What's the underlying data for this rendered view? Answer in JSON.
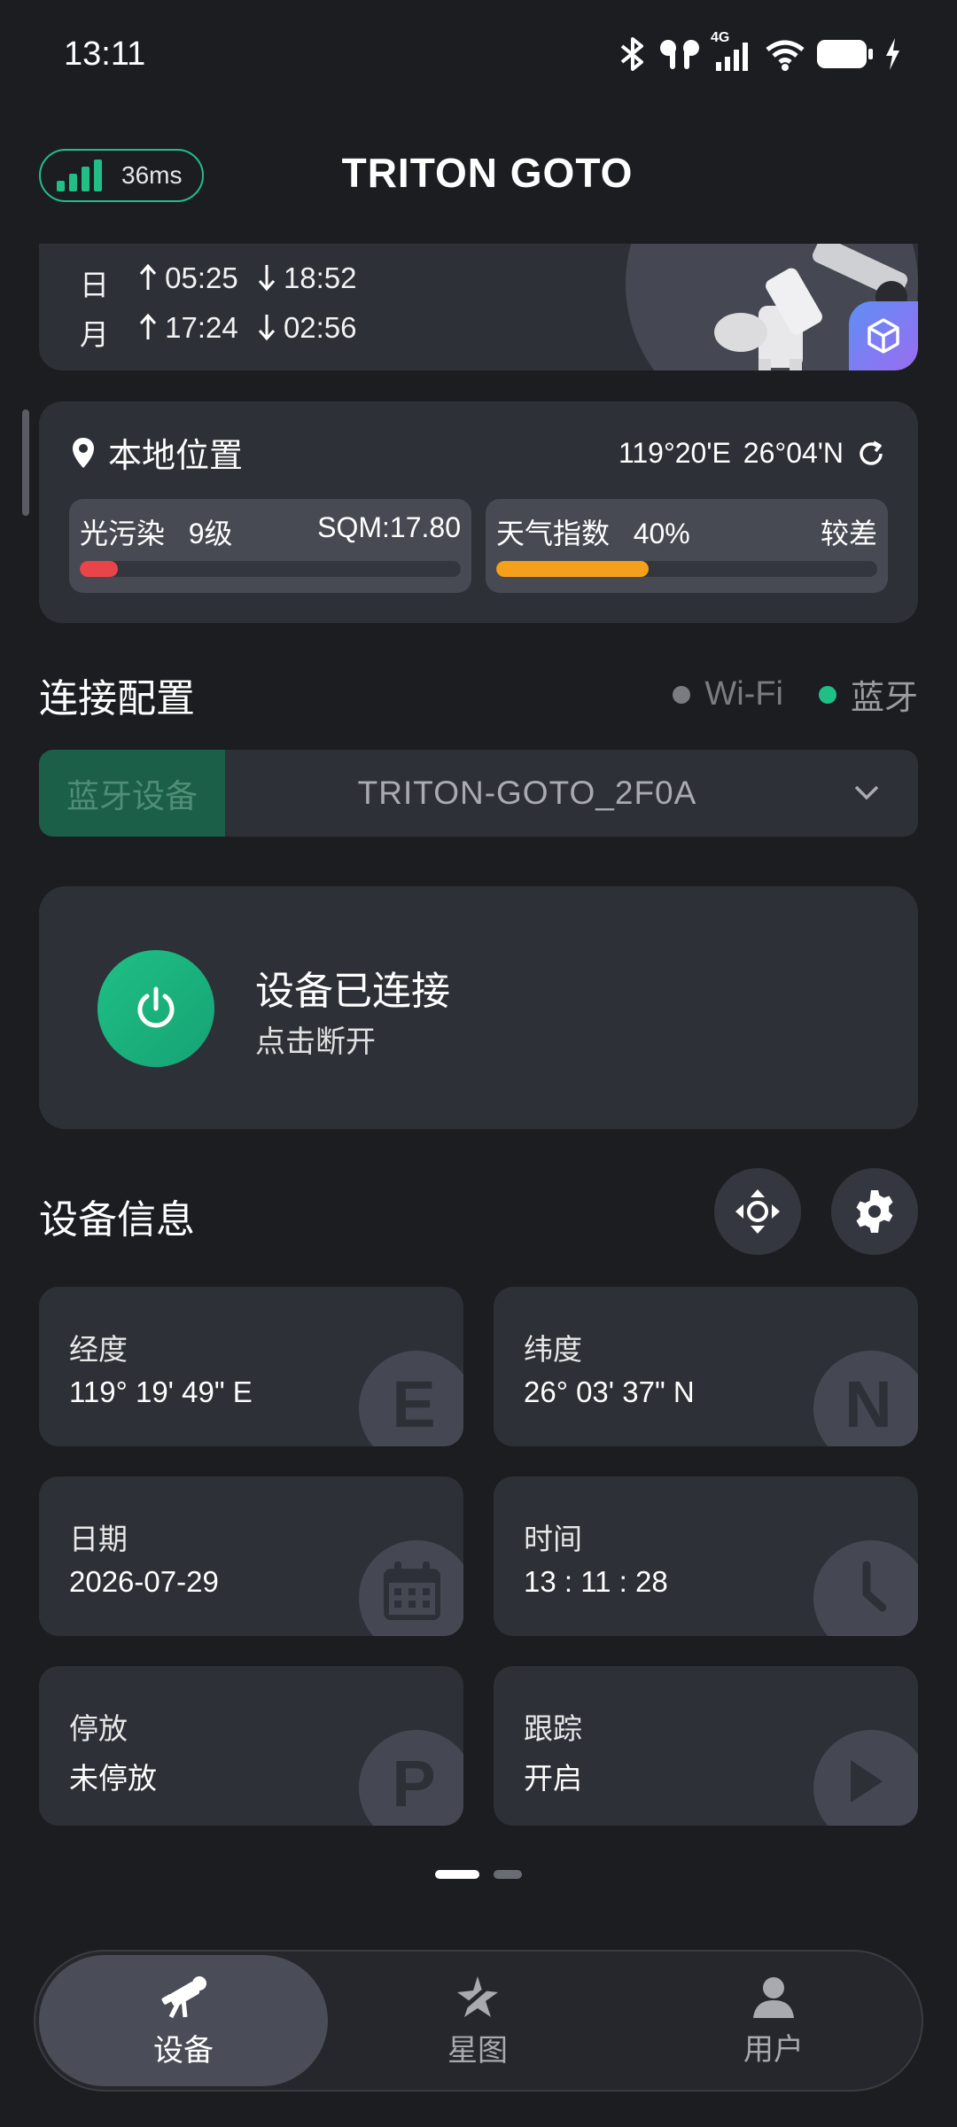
{
  "status_bar": {
    "time": "13:11",
    "network_label": "4G"
  },
  "header": {
    "latency": "36ms",
    "title": "TRITON GOTO"
  },
  "sun_moon": {
    "sun_label": "日",
    "sunrise": "05:25",
    "sunset": "18:52",
    "moon_label": "月",
    "moonrise": "17:24",
    "moonset": "02:56"
  },
  "location": {
    "title": "本地位置",
    "longitude": "119°20'E",
    "latitude": "26°04'N",
    "light_pollution": {
      "label": "光污染",
      "level": "9级",
      "sqm": "SQM:17.80",
      "fill_fraction": 0.1,
      "color": "#e9444a"
    },
    "weather": {
      "label": "天气指数",
      "percent": "40%",
      "rating": "较差",
      "fill_fraction": 0.4,
      "color": "#f5a01a"
    }
  },
  "connection": {
    "title": "连接配置",
    "modes": [
      {
        "label": "Wi-Fi",
        "color": "#7a7c82"
      },
      {
        "label": "蓝牙",
        "color": "#1fbf86"
      }
    ],
    "device_tag": "蓝牙设备",
    "device_name": "TRITON-GOTO_2F0A",
    "status": "设备已连接",
    "action": "点击断开"
  },
  "device_info": {
    "title": "设备信息",
    "tiles": [
      {
        "label": "经度",
        "value": "119° 19' 49\" E",
        "icon": "E"
      },
      {
        "label": "纬度",
        "value": "26° 03' 37\" N",
        "icon": "N"
      },
      {
        "label": "日期",
        "value": "2026-07-29",
        "icon": "calendar-icon"
      },
      {
        "label": "时间",
        "value": "13 : 11 : 28",
        "icon": "clock-icon"
      },
      {
        "label": "停放",
        "value": "未停放",
        "icon": "P"
      },
      {
        "label": "跟踪",
        "value": "开启",
        "icon": "play-icon"
      }
    ]
  },
  "pager": {
    "count": 2,
    "active": 1
  },
  "nav": [
    {
      "label": "设备",
      "icon": "telescope-icon",
      "active": true
    },
    {
      "label": "星图",
      "icon": "star-chart-icon",
      "active": false
    },
    {
      "label": "用户",
      "icon": "user-icon",
      "active": false
    }
  ],
  "colors": {
    "accent": "#1fbf86",
    "card": "#2e3038",
    "background": "#1c1d21"
  }
}
